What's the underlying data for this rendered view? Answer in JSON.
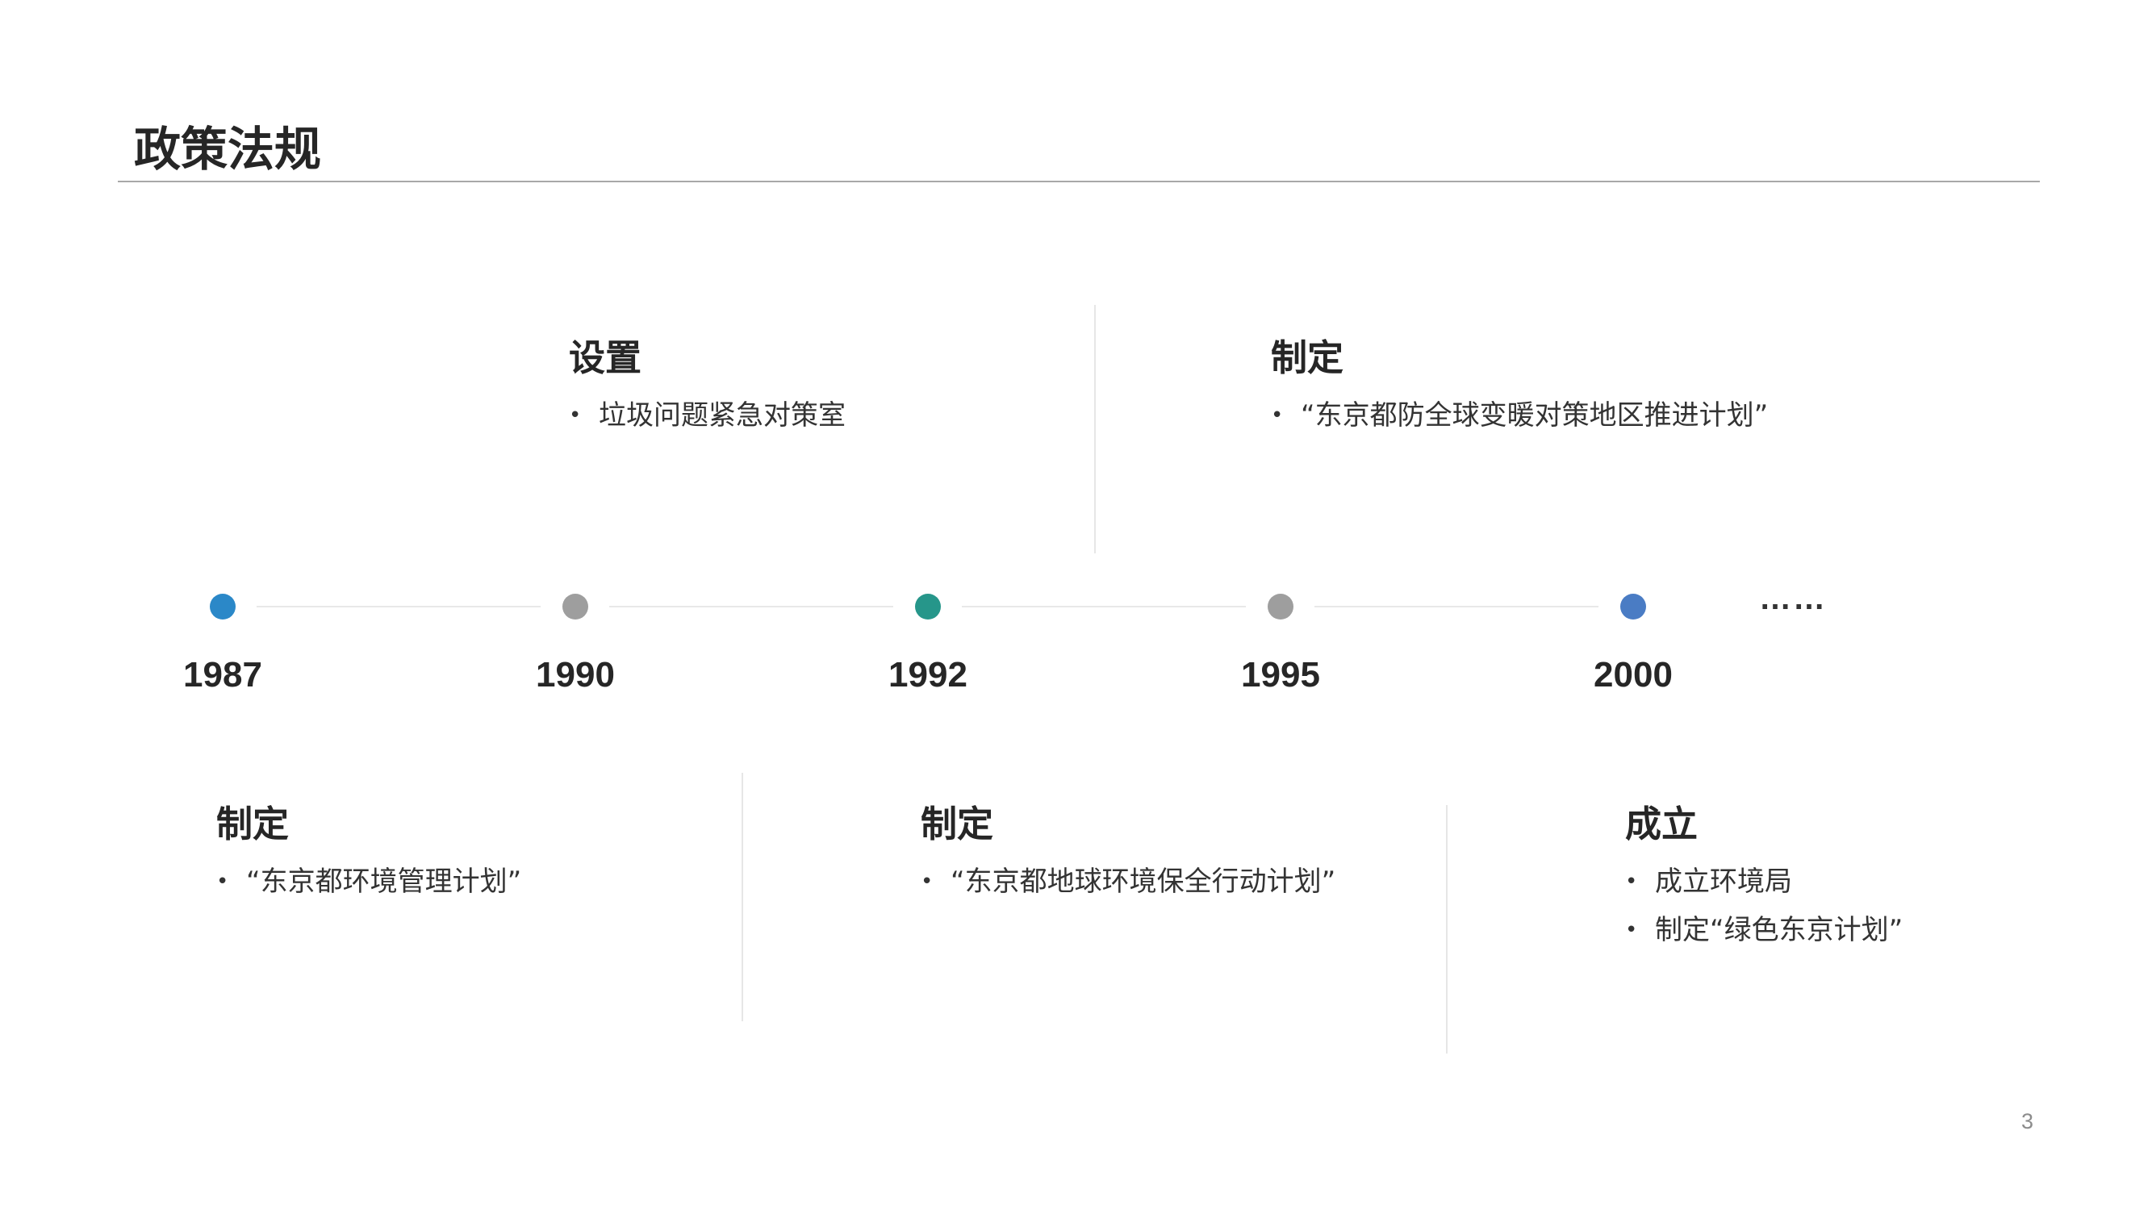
{
  "slide": {
    "title": "政策法规",
    "page_number": "3",
    "ellipsis": "……"
  },
  "colors": {
    "dot_1987": "#2b88c8",
    "dot_1990": "#9e9e9e",
    "dot_1992": "#26968a",
    "dot_1995": "#9e9e9e",
    "dot_2000": "#4a7cc4"
  },
  "timeline": {
    "years": [
      "1987",
      "1990",
      "1992",
      "1995",
      "2000"
    ]
  },
  "events": {
    "top": [
      {
        "year": "1990",
        "heading": "设置",
        "bullet": "•",
        "items": [
          "垃圾问题紧急对策室"
        ]
      },
      {
        "year": "1995",
        "heading": "制定",
        "bullet": "•",
        "items": [
          "“东京都防全球变暖对策地区推进计划”"
        ]
      }
    ],
    "bottom": [
      {
        "year": "1987",
        "heading": "制定",
        "bullet": "•",
        "items": [
          "“东京都环境管理计划”"
        ]
      },
      {
        "year": "1992",
        "heading": "制定",
        "bullet": "•",
        "items": [
          "“东京都地球环境保全行动计划”"
        ]
      },
      {
        "year": "2000",
        "heading": "成立",
        "bullet": "•",
        "items": [
          "成立环境局",
          "制定“绿色东京计划”"
        ]
      }
    ]
  }
}
